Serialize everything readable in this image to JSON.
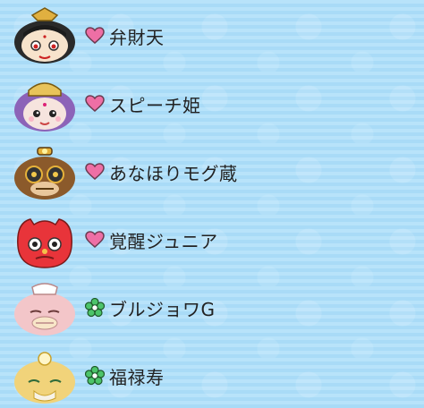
{
  "characters": [
    {
      "name": "弁財天",
      "badge": "heart-icon",
      "badge_color": "#ee6fa5"
    },
    {
      "name": "スピーチ姫",
      "badge": "heart-icon",
      "badge_color": "#ee6fa5"
    },
    {
      "name": "あなほりモグ蔵",
      "badge": "heart-icon",
      "badge_color": "#ee6fa5"
    },
    {
      "name": "覚醒ジュニア",
      "badge": "heart-icon",
      "badge_color": "#ee6fa5"
    },
    {
      "name": "ブルジョワG",
      "badge": "flower-icon",
      "badge_color": "#4cc46a"
    },
    {
      "name": "福禄寿",
      "badge": "flower-icon",
      "badge_color": "#4cc46a"
    }
  ]
}
